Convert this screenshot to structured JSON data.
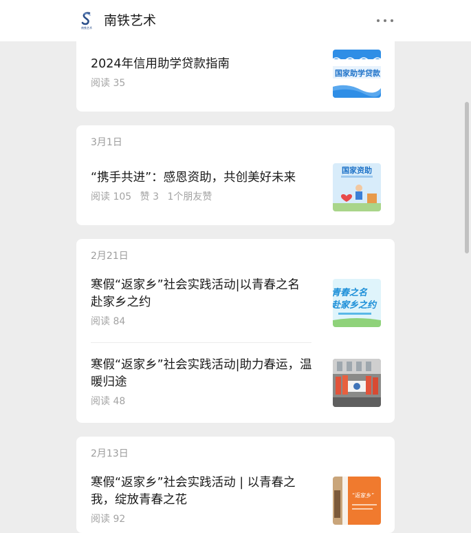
{
  "header": {
    "account_name": "南铁艺术",
    "logo_text": "南铁艺术"
  },
  "groups": [
    {
      "date": "",
      "articles": [
        {
          "title": "2024年信用助学贷款指南",
          "read": "阅读 35",
          "likes": "",
          "friends": "",
          "thumb_text": "国家助学贷款"
        }
      ]
    },
    {
      "date": "3月1日",
      "articles": [
        {
          "title": "“携手共进”：感恩资助，共创美好未来",
          "read": "阅读 105",
          "likes": "赞 3",
          "friends": "1个朋友赞",
          "thumb_text": "国家资助"
        }
      ]
    },
    {
      "date": "2月21日",
      "articles": [
        {
          "title": "寒假“返家乡”社会实践活动|以青春之名 赴家乡之约",
          "read": "阅读 84",
          "likes": "",
          "friends": "",
          "thumb_line1": "青春之名",
          "thumb_line2": "赴家乡之约"
        },
        {
          "title": "寒假“返家乡”社会实践活动|助力春运，温暖归途",
          "read": "阅读 48",
          "likes": "",
          "friends": "",
          "thumb_text": ""
        }
      ]
    },
    {
      "date": "2月13日",
      "articles": [
        {
          "title": "寒假“返家乡”社会实践活动 | 以青春之我，绽放青春之花",
          "read": "阅读 92",
          "likes": "",
          "friends": "",
          "thumb_text": "“返家乡”"
        }
      ]
    }
  ],
  "colors": {
    "background": "#ededed",
    "card": "#ffffff",
    "title": "#1a1a1a",
    "meta": "#a3a3a3",
    "accent_blue": "#2f8ee6",
    "accent_orange": "#f07a2e"
  }
}
